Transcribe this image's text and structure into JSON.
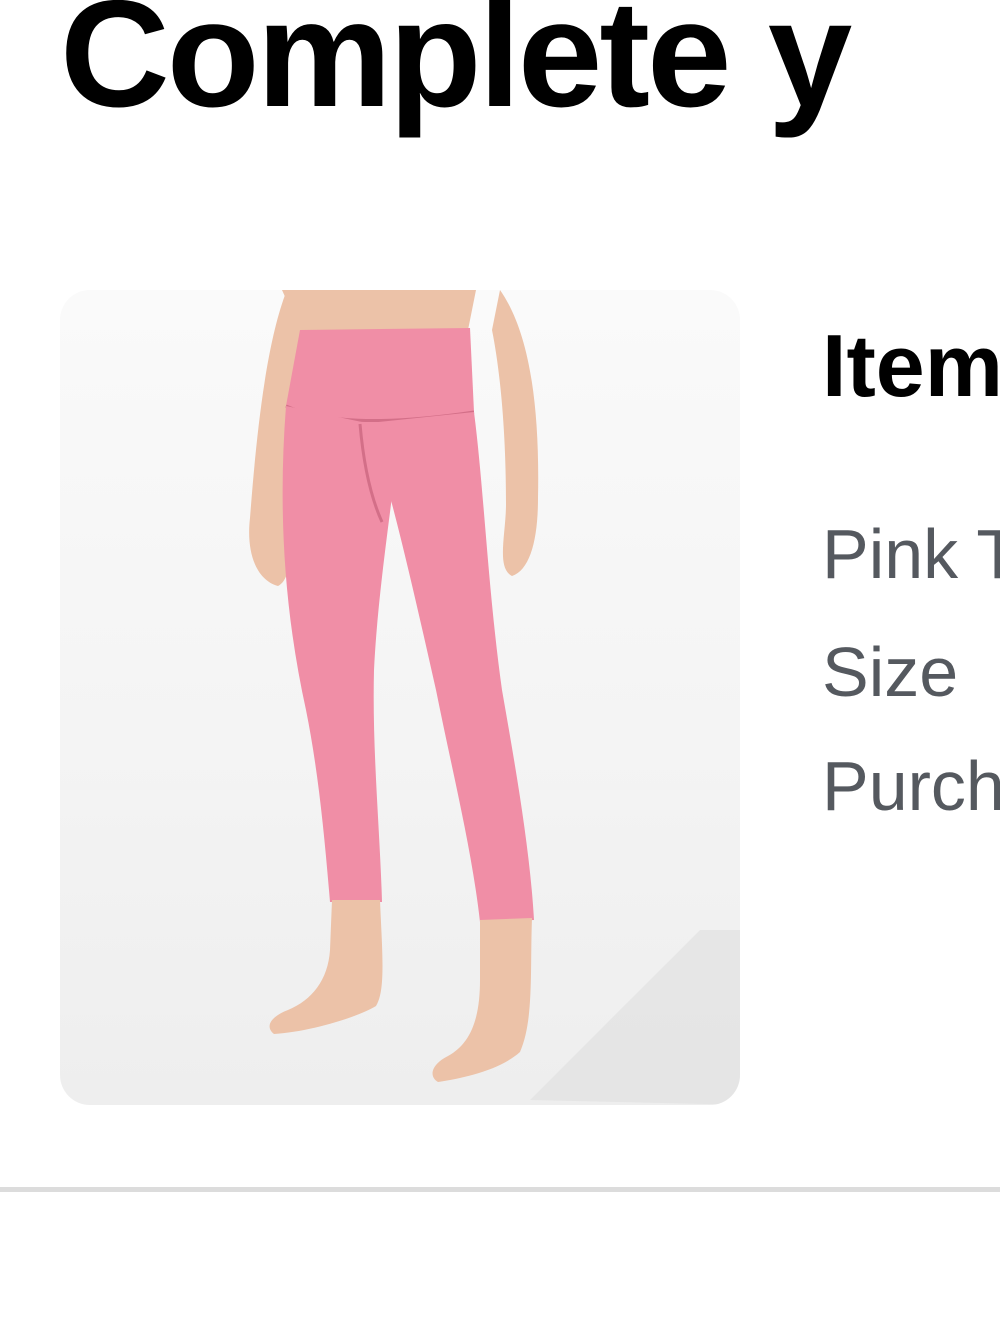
{
  "header": {
    "title": "Complete y"
  },
  "product": {
    "image_alt": "pink high-rise leggings",
    "image_accent_color": "#f08ea6",
    "heading": "Item",
    "details": [
      "Pink T",
      "Size",
      "Purch"
    ]
  }
}
